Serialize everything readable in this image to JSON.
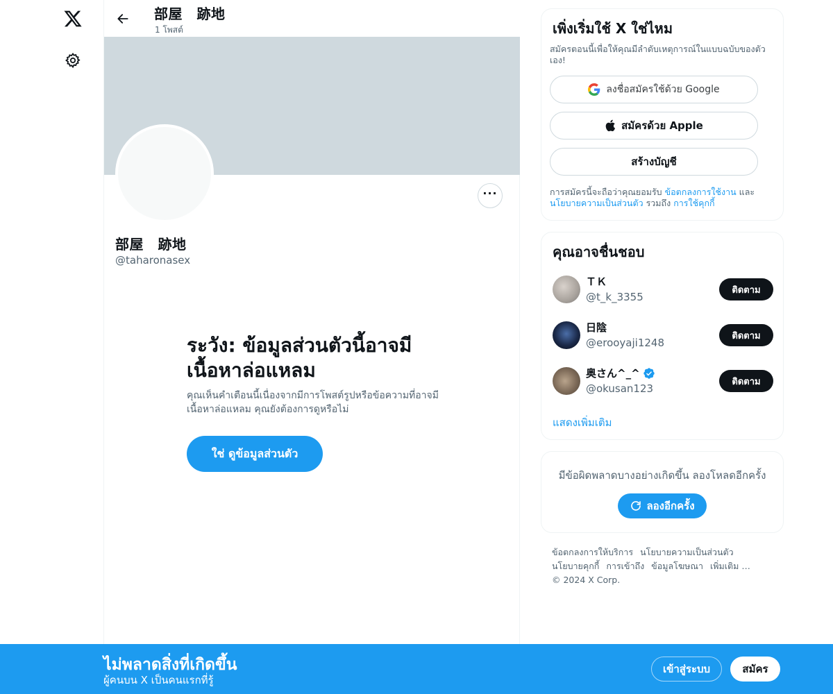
{
  "colors": {
    "accent": "#1d9bf0",
    "text_primary": "#0f1419",
    "text_secondary": "#536471",
    "banner": "#cfd9de",
    "border": "#eff3f4"
  },
  "nav": {
    "logo_icon": "x-logo-icon",
    "settings_icon": "gear-icon"
  },
  "header": {
    "title": "部屋　跡地",
    "post_count": "1 โพสต์"
  },
  "profile": {
    "name": "部屋　跡地",
    "handle": "@taharonasex"
  },
  "warning": {
    "title": "ระวัง: ข้อมูลส่วนตัวนี้อาจมีเนื้อหาล่อแหลม",
    "body": "คุณเห็นคำเตือนนี้เนื่องจากมีการโพสต์รูปหรือข้อความที่อาจมีเนื้อหาล่อแหลม คุณยังต้องการดูหรือไม่",
    "button": "ใช่ ดูข้อมูลส่วนตัว"
  },
  "signup_card": {
    "title": "เพิ่งเริ่มใช้ X ใช่ไหม",
    "description": "สมัครตอนนี้เพื่อให้คุณมีลำดับเหตุการณ์ในแบบฉบับของตัวเอง!",
    "google_button": "ลงชื่อสมัครใช้ด้วย Google",
    "apple_button": "สมัครด้วย Apple",
    "create_button": "สร้างบัญชี",
    "terms_prefix": "การสมัครนี้จะถือว่าคุณยอมรับ ",
    "terms_link": "ข้อตกลงการใช้งาน",
    "terms_and": " และ ",
    "privacy_link": "นโยบายความเป็นส่วนตัว",
    "terms_including": " รวมถึง ",
    "cookie_link": "การใช้คุกกี้"
  },
  "who_to_follow": {
    "title": "คุณอาจชื่นชอบ",
    "users": [
      {
        "name": "ＴＫ",
        "handle": "@t_k_3355",
        "follow_label": "ติดตาม",
        "verified": false
      },
      {
        "name": "日陰",
        "handle": "@erooyaji1248",
        "follow_label": "ติดตาม",
        "verified": false
      },
      {
        "name": "奥さん^_^",
        "handle": "@okusan123",
        "follow_label": "ติดตาม",
        "verified": true
      }
    ],
    "show_more": "แสดงเพิ่มเติม"
  },
  "error_card": {
    "message": "มีข้อผิดพลาดบางอย่างเกิดขึ้น ลองโหลดอีกครั้ง",
    "retry": "ลองอีกครั้ง"
  },
  "footer": {
    "links": [
      "ข้อตกลงการให้บริการ",
      "นโยบายความเป็นส่วนตัว",
      "นโยบายคุกกี้",
      "การเข้าถึง",
      "ข้อมูลโฆษณา",
      "เพิ่มเติม …"
    ],
    "copyright": "© 2024 X Corp."
  },
  "bottom_bar": {
    "title": "ไม่พลาดสิ่งที่เกิดขึ้น",
    "subtitle": "ผู้คนบน X เป็นคนแรกที่รู้",
    "login": "เข้าสู่ระบบ",
    "signup": "สมัคร"
  }
}
